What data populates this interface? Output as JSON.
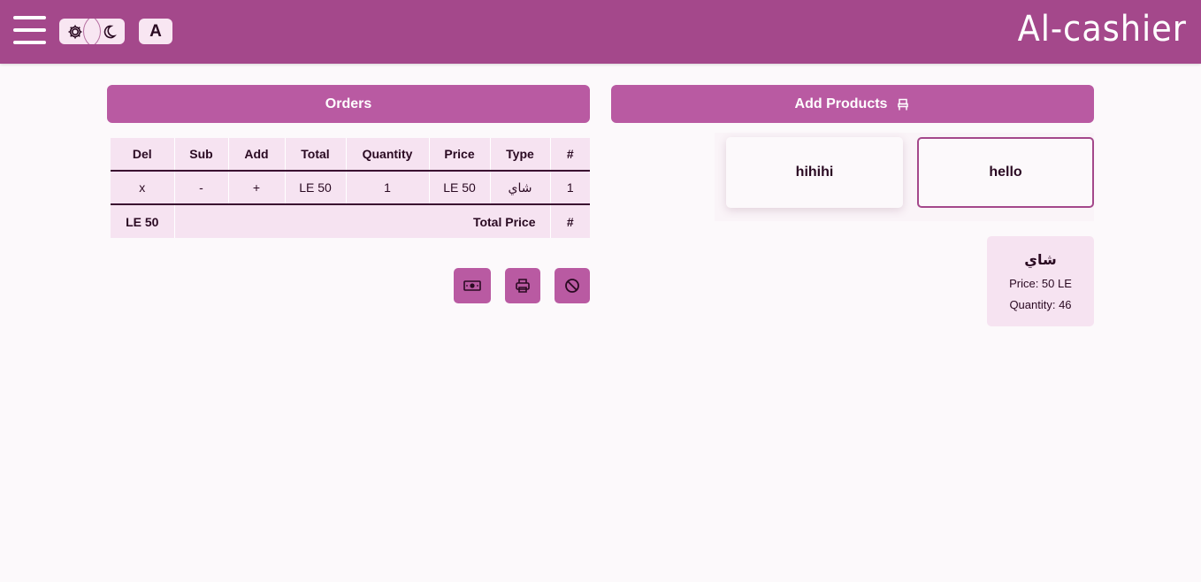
{
  "header": {
    "brand": "Al-cashier",
    "lang_button": "A"
  },
  "colors": {
    "header_bg": "#a4488b",
    "accent": "#b95aa2",
    "row_bg": "#f6e3f1"
  },
  "orders": {
    "title": "Orders",
    "columns": [
      "Del",
      "Sub",
      "Add",
      "Total",
      "Quantity",
      "Price",
      "Type",
      "#"
    ],
    "rows": [
      {
        "del": "x",
        "sub": "-",
        "add": "+",
        "total": "LE 50",
        "quantity": "1",
        "price": "LE 50",
        "type": "شاي",
        "num": "1"
      }
    ],
    "footer": {
      "currency": "LE",
      "amount": "50",
      "label": "Total Price",
      "hash": "#"
    },
    "actions": [
      {
        "name": "cash-icon"
      },
      {
        "name": "print-icon"
      },
      {
        "name": "cancel-icon"
      }
    ]
  },
  "products": {
    "title": "Add Products",
    "title_icon": "chair-icon",
    "categories": [
      "hihihi",
      "hello"
    ],
    "selected_category": "hello",
    "items": [
      {
        "name": "شاي",
        "price_line": "Price: 50 LE",
        "quantity_line": "Quantity: 46"
      }
    ]
  }
}
